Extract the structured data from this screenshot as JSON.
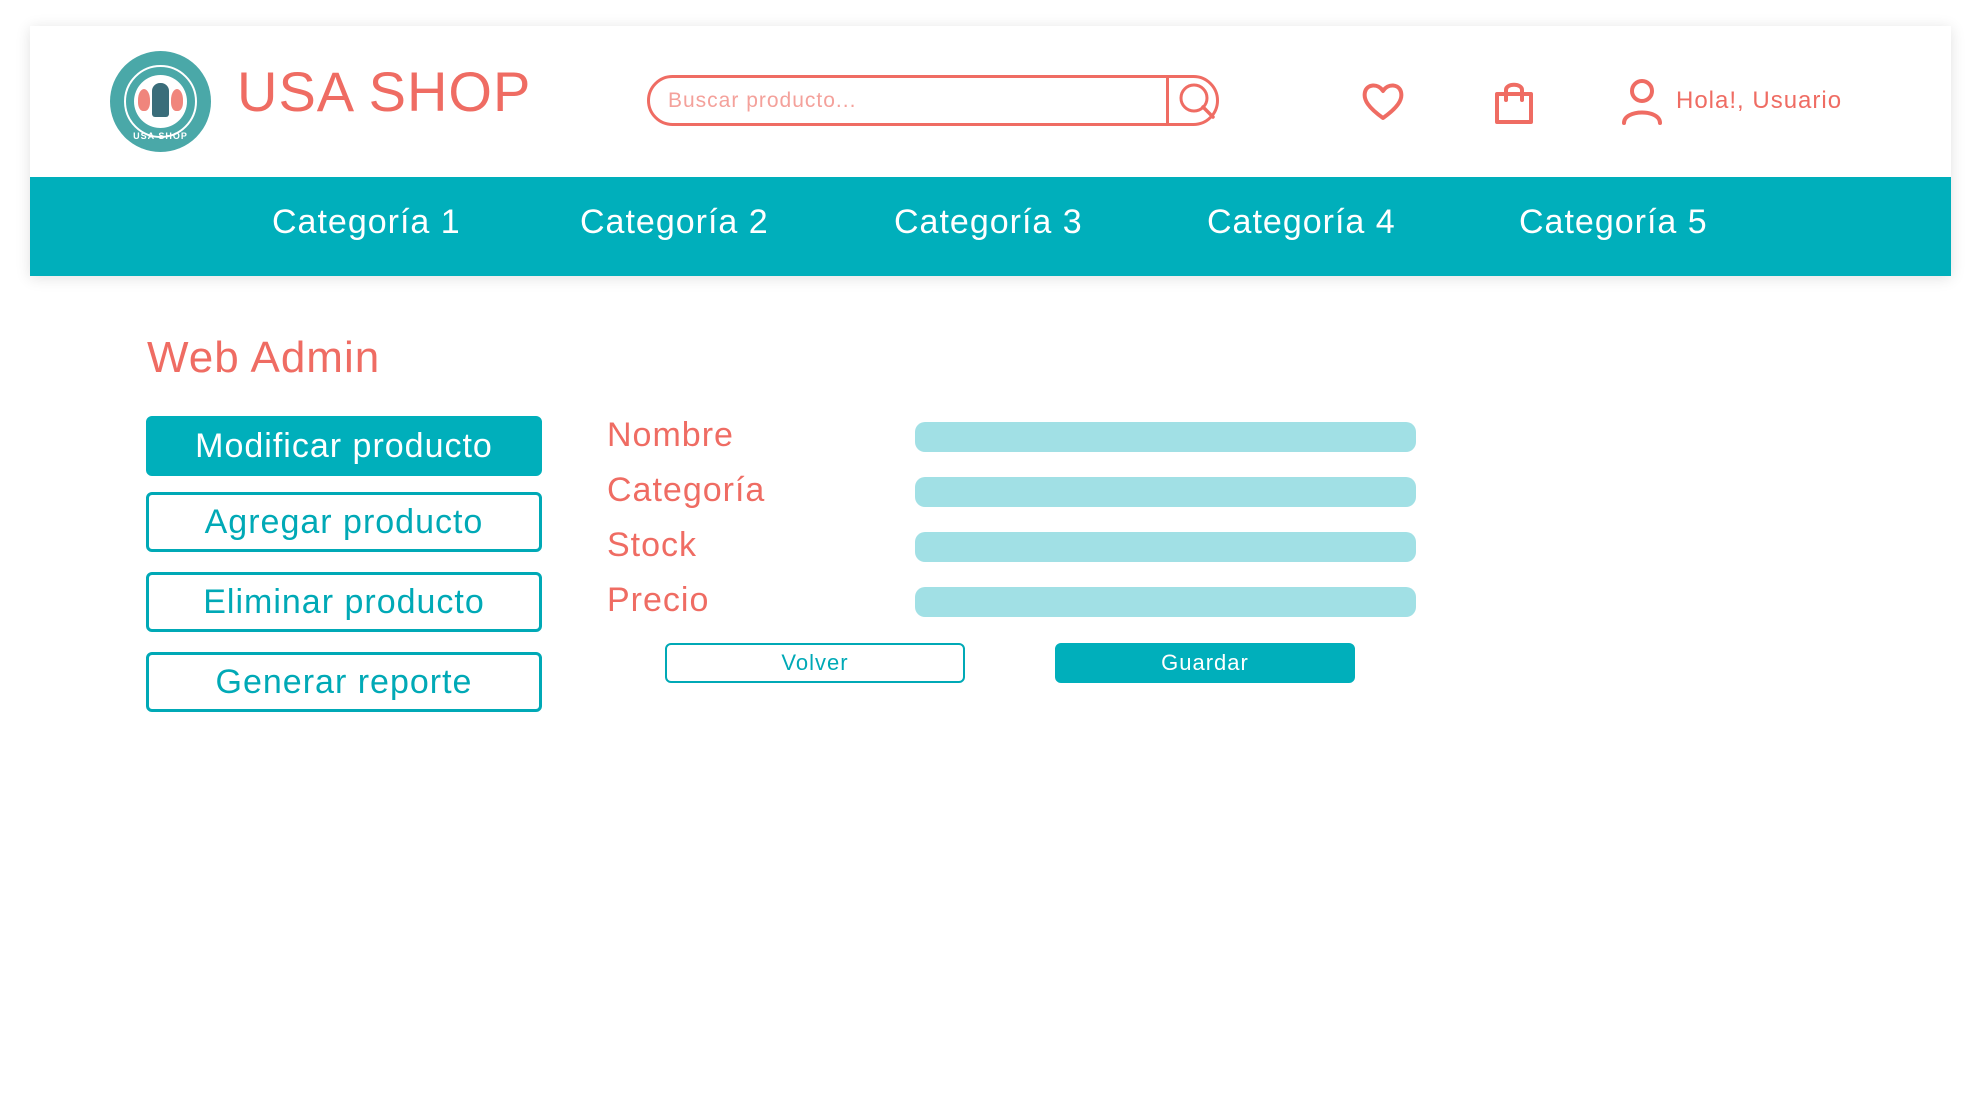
{
  "header": {
    "logo": {
      "icon": "usa-shop-logo-badge",
      "badge_text": "USA SHOP"
    },
    "brand": "USA SHOP",
    "search": {
      "placeholder": "Buscar producto...",
      "value": "",
      "icon": "search-icon"
    },
    "wishlist_icon": "heart-icon",
    "cart_icon": "shopping-bag-icon",
    "user": {
      "icon": "user-icon",
      "greeting": "Hola!, Usuario"
    }
  },
  "nav": {
    "categories": [
      "Categoría 1",
      "Categoría 2",
      "Categoría 3",
      "Categoría 4",
      "Categoría 5"
    ]
  },
  "main": {
    "title": "Web Admin",
    "sidebar": {
      "items": [
        {
          "label": "Modificar producto",
          "active": true
        },
        {
          "label": "Agregar producto",
          "active": false
        },
        {
          "label": "Eliminar producto",
          "active": false
        },
        {
          "label": "Generar reporte",
          "active": false
        }
      ]
    },
    "form": {
      "fields": [
        {
          "label": "Nombre",
          "value": ""
        },
        {
          "label": "Categoría",
          "value": ""
        },
        {
          "label": "Stock",
          "value": ""
        },
        {
          "label": "Precio",
          "value": ""
        }
      ],
      "back_label": "Volver",
      "save_label": "Guardar"
    }
  },
  "colors": {
    "brand_coral": "#ef6c63",
    "accent_teal": "#00afbb",
    "input_fill": "#a1e0e5",
    "logo_teal": "#4aa8a8"
  }
}
